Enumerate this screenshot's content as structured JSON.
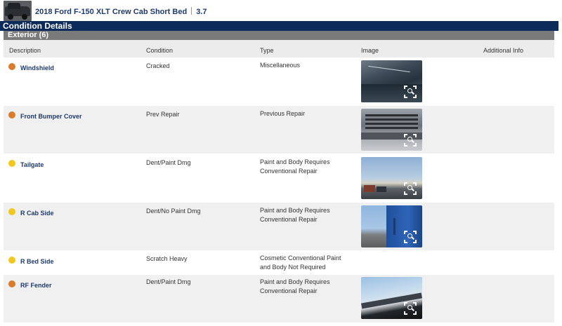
{
  "vehicle": {
    "title": "2018 Ford F-150 XLT Crew Cab Short Bed",
    "engine": "3.7",
    "thumbnail": "truck-thumbnail"
  },
  "condition_details": {
    "header": "Condition Details",
    "section_title": "Exterior (6)",
    "columns": {
      "description": "Description",
      "condition": "Condition",
      "type": "Type",
      "image": "Image",
      "additional_info": "Additional Info"
    },
    "items": [
      {
        "description": "Windshield",
        "condition": "Cracked",
        "type": "Miscellaneous",
        "severity_color": "#d97b2b",
        "has_image": true
      },
      {
        "description": "Front Bumper Cover",
        "condition": "Prev Repair",
        "type": "Previous Repair",
        "severity_color": "#d97b2b",
        "has_image": true
      },
      {
        "description": "Tailgate",
        "condition": "Dent/Paint Dmg",
        "type": "Paint and Body Requires Conventional Repair",
        "severity_color": "#f2c81e",
        "has_image": true
      },
      {
        "description": "R Cab Side",
        "condition": "Dent/No Paint Dmg",
        "type": "Paint and Body Requires Conventional Repair",
        "severity_color": "#f2c81e",
        "has_image": true
      },
      {
        "description": "R Bed Side",
        "condition": "Scratch Heavy",
        "type": "Cosmetic Conventional Paint and Body Not Required",
        "severity_color": "#f2c81e",
        "has_image": false
      },
      {
        "description": "RF Fender",
        "condition": "Dent/Paint Dmg",
        "type": "Paint and Body Requires Conventional Repair",
        "severity_color": "#d97b2b",
        "has_image": true
      }
    ]
  },
  "colors": {
    "header_navy": "#0c2a5a",
    "section_gray": "#7a7a7a",
    "link_blue": "#1f3a6a",
    "severity_orange": "#d97b2b",
    "severity_yellow": "#f2c81e"
  }
}
